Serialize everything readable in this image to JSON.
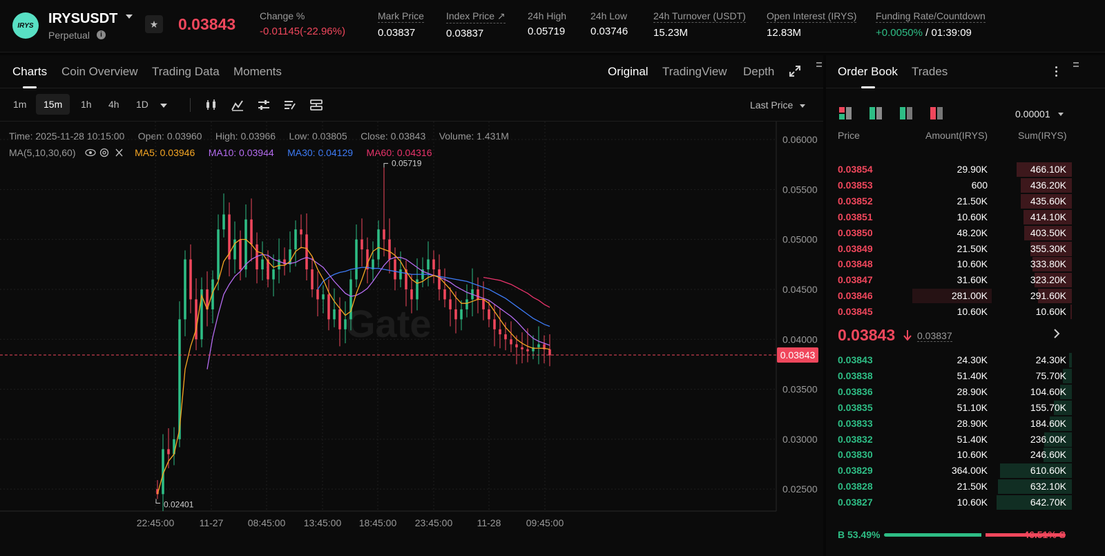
{
  "header": {
    "logo_text": "IRYS",
    "symbol": "IRYSUSDT",
    "contract_type": "Perpetual",
    "last_price": "0.03843",
    "stats": [
      {
        "label": "Change %",
        "value": "-0.01145(-22.96%)",
        "tone": "red"
      },
      {
        "label": "Mark Price",
        "value": "0.03837"
      },
      {
        "label": "Index Price ↗",
        "value": "0.03837"
      },
      {
        "label": "24h High",
        "value": "0.05719"
      },
      {
        "label": "24h Low",
        "value": "0.03746"
      },
      {
        "label": "24h Turnover (USDT)",
        "value": "15.23M"
      },
      {
        "label": "Open Interest (IRYS)",
        "value": "12.83M"
      },
      {
        "label": "Funding Rate/Countdown",
        "value_green": "+0.0050%",
        "value_rest": " / 01:39:09"
      }
    ]
  },
  "chart_tabs": [
    "Charts",
    "Coin Overview",
    "Trading Data",
    "Moments"
  ],
  "view_tabs": [
    "Original",
    "TradingView",
    "Depth"
  ],
  "timeframes": [
    "1m",
    "15m",
    "1h",
    "4h",
    "1D"
  ],
  "active_timeframe": "15m",
  "price_source": "Last Price",
  "candle_info": {
    "time": "Time: 2025-11-28 10:15:00",
    "open": "Open: 0.03960",
    "high": "High: 0.03966",
    "low": "Low: 0.03805",
    "close": "Close: 0.03843",
    "volume": "Volume: 1.431M"
  },
  "ma_legend": {
    "label": "MA(5,10,30,60)",
    "ma5": "MA5: 0.03946",
    "ma10": "MA10: 0.03944",
    "ma30": "MA30: 0.04129",
    "ma60": "MA60: 0.04316"
  },
  "chart_data": {
    "type": "candlestick",
    "y_ticks": [
      "0.06000",
      "0.05500",
      "0.05000",
      "0.04500",
      "0.04000",
      "0.03500",
      "0.03000",
      "0.02500"
    ],
    "ylim": [
      0.0228,
      0.0618
    ],
    "x_ticks": [
      "22:45:00",
      "11-27",
      "08:45:00",
      "13:45:00",
      "18:45:00",
      "23:45:00",
      "11-28",
      "09:45:00"
    ],
    "high_marker": "0.05719",
    "low_marker": "0.02401",
    "last_price_label": "0.03843",
    "last_price": 0.03843,
    "candle_count": 72,
    "closes": [
      0.0245,
      0.029,
      0.0285,
      0.03,
      0.042,
      0.048,
      0.044,
      0.04,
      0.045,
      0.043,
      0.046,
      0.051,
      0.0525,
      0.048,
      0.05,
      0.047,
      0.052,
      0.0495,
      0.047,
      0.048,
      0.046,
      0.047,
      0.048,
      0.0475,
      0.049,
      0.051,
      0.0505,
      0.047,
      0.045,
      0.044,
      0.0445,
      0.042,
      0.043,
      0.041,
      0.042,
      0.046,
      0.05,
      0.049,
      0.047,
      0.048,
      0.051,
      0.05,
      0.048,
      0.046,
      0.047,
      0.045,
      0.044,
      0.046,
      0.047,
      0.048,
      0.047,
      0.045,
      0.044,
      0.043,
      0.042,
      0.043,
      0.044,
      0.045,
      0.044,
      0.043,
      0.042,
      0.041,
      0.0405,
      0.04,
      0.0395,
      0.0392,
      0.039,
      0.0388,
      0.0392,
      0.0395,
      0.039,
      0.0384
    ],
    "ma5": [
      0.0245,
      0.0265,
      0.0278,
      0.0285,
      0.031,
      0.037,
      0.0393,
      0.041,
      0.0444,
      0.043,
      0.0447,
      0.0458,
      0.0478,
      0.0486,
      0.0496,
      0.05,
      0.05,
      0.0495,
      0.0488,
      0.0486,
      0.0478,
      0.0472,
      0.0474,
      0.0474,
      0.0478,
      0.0488,
      0.0492,
      0.0491,
      0.0483,
      0.047,
      0.046,
      0.0447,
      0.0438,
      0.0431,
      0.0424,
      0.0428,
      0.0446,
      0.046,
      0.0476,
      0.0488,
      0.0492,
      0.049,
      0.0488,
      0.0484,
      0.0478,
      0.0468,
      0.046,
      0.0456,
      0.0458,
      0.0462,
      0.0464,
      0.0462,
      0.0456,
      0.045,
      0.0442,
      0.0436,
      0.0436,
      0.0438,
      0.044,
      0.044,
      0.0436,
      0.0428,
      0.042,
      0.0412,
      0.0406,
      0.04,
      0.0396,
      0.0393,
      0.0391,
      0.0391,
      0.0391,
      0.039
    ],
    "ma10": [
      null,
      null,
      null,
      null,
      null,
      null,
      null,
      null,
      null,
      0.037,
      0.0402,
      0.0425,
      0.0445,
      0.0455,
      0.0463,
      0.0468,
      0.0475,
      0.048,
      0.0483,
      0.0485,
      0.0484,
      0.048,
      0.0478,
      0.0476,
      0.0476,
      0.0477,
      0.048,
      0.0482,
      0.048,
      0.0476,
      0.0472,
      0.0465,
      0.0458,
      0.0452,
      0.0446,
      0.0443,
      0.0444,
      0.0447,
      0.0451,
      0.0458,
      0.0466,
      0.0474,
      0.048,
      0.0482,
      0.0482,
      0.048,
      0.0476,
      0.0472,
      0.0468,
      0.0466,
      0.0464,
      0.0462,
      0.046,
      0.0457,
      0.0453,
      0.045,
      0.0447,
      0.0445,
      0.0443,
      0.0441,
      0.0439,
      0.0435,
      0.0431,
      0.0427,
      0.0423,
      0.0418,
      0.0412,
      0.0406,
      0.0401,
      0.0398,
      0.0396,
      0.0394
    ],
    "ma30": [
      null,
      null,
      null,
      null,
      null,
      null,
      null,
      null,
      null,
      null,
      null,
      null,
      null,
      null,
      null,
      null,
      null,
      null,
      null,
      null,
      null,
      null,
      null,
      null,
      null,
      null,
      null,
      null,
      null,
      0.045,
      0.0458,
      0.0462,
      0.0465,
      0.0467,
      0.0468,
      0.047,
      0.0471,
      0.0472,
      0.0472,
      0.0471,
      0.0471,
      0.047,
      0.0469,
      0.0468,
      0.0467,
      0.0466,
      0.0465,
      0.0465,
      0.0465,
      0.0465,
      0.0464,
      0.0463,
      0.0462,
      0.0461,
      0.046,
      0.0459,
      0.0458,
      0.0456,
      0.0454,
      0.0452,
      0.045,
      0.0447,
      0.0444,
      0.0441,
      0.0437,
      0.0433,
      0.0429,
      0.0425,
      0.0421,
      0.0418,
      0.0415,
      0.0413
    ],
    "ma60": [
      null,
      null,
      null,
      null,
      null,
      null,
      null,
      null,
      null,
      null,
      null,
      null,
      null,
      null,
      null,
      null,
      null,
      null,
      null,
      null,
      null,
      null,
      null,
      null,
      null,
      null,
      null,
      null,
      null,
      null,
      null,
      null,
      null,
      null,
      null,
      null,
      null,
      null,
      null,
      null,
      null,
      null,
      null,
      null,
      null,
      null,
      null,
      null,
      null,
      null,
      null,
      null,
      null,
      null,
      null,
      null,
      null,
      null,
      null,
      0.0462,
      0.0461,
      0.046,
      0.0459,
      0.0457,
      0.0455,
      0.0452,
      0.0449,
      0.0446,
      0.0442,
      0.0439,
      0.0435,
      0.0432
    ]
  },
  "order_book": {
    "tabs": [
      "Order Book",
      "Trades"
    ],
    "precision": "0.00001",
    "columns": [
      "Price",
      "Amount(IRYS)",
      "Sum(IRYS)"
    ],
    "asks": [
      {
        "price": "0.03854",
        "amount": "29.90K",
        "sum": "466.10K",
        "depth": 0.73
      },
      {
        "price": "0.03853",
        "amount": "600",
        "sum": "436.20K",
        "depth": 0.68
      },
      {
        "price": "0.03852",
        "amount": "21.50K",
        "sum": "435.60K",
        "depth": 0.68
      },
      {
        "price": "0.03851",
        "amount": "10.60K",
        "sum": "414.10K",
        "depth": 0.64
      },
      {
        "price": "0.03850",
        "amount": "48.20K",
        "sum": "403.50K",
        "depth": 0.63
      },
      {
        "price": "0.03849",
        "amount": "21.50K",
        "sum": "355.30K",
        "depth": 0.55
      },
      {
        "price": "0.03848",
        "amount": "10.60K",
        "sum": "333.80K",
        "depth": 0.52
      },
      {
        "price": "0.03847",
        "amount": "31.60K",
        "sum": "323.20K",
        "depth": 0.5
      },
      {
        "price": "0.03846",
        "amount": "281.00K",
        "sum": "291.60K",
        "depth": 0.45
      },
      {
        "price": "0.03845",
        "amount": "10.60K",
        "sum": "10.60K",
        "depth": 0.02
      }
    ],
    "mid_price": "0.03843",
    "mark_price": "0.03837",
    "bids": [
      {
        "price": "0.03843",
        "amount": "24.30K",
        "sum": "24.30K",
        "depth": 0.04
      },
      {
        "price": "0.03838",
        "amount": "51.40K",
        "sum": "75.70K",
        "depth": 0.12
      },
      {
        "price": "0.03836",
        "amount": "28.90K",
        "sum": "104.60K",
        "depth": 0.16
      },
      {
        "price": "0.03835",
        "amount": "51.10K",
        "sum": "155.70K",
        "depth": 0.24
      },
      {
        "price": "0.03833",
        "amount": "28.90K",
        "sum": "184.60K",
        "depth": 0.29
      },
      {
        "price": "0.03832",
        "amount": "51.40K",
        "sum": "236.00K",
        "depth": 0.37
      },
      {
        "price": "0.03830",
        "amount": "10.60K",
        "sum": "246.60K",
        "depth": 0.38
      },
      {
        "price": "0.03829",
        "amount": "364.00K",
        "sum": "610.60K",
        "depth": 0.95
      },
      {
        "price": "0.03828",
        "amount": "21.50K",
        "sum": "632.10K",
        "depth": 0.98
      },
      {
        "price": "0.03827",
        "amount": "10.60K",
        "sum": "642.70K",
        "depth": 1.0
      }
    ],
    "buy_label": "B 53.49%",
    "sell_label": "46.51% S",
    "buy_ratio": 0.5349
  },
  "colors": {
    "red": "#f0475c",
    "green": "#2ebd85",
    "ma5": "#f5a623",
    "ma10": "#b56cf0",
    "ma30": "#3d7bf5",
    "ma60": "#e8336b"
  }
}
